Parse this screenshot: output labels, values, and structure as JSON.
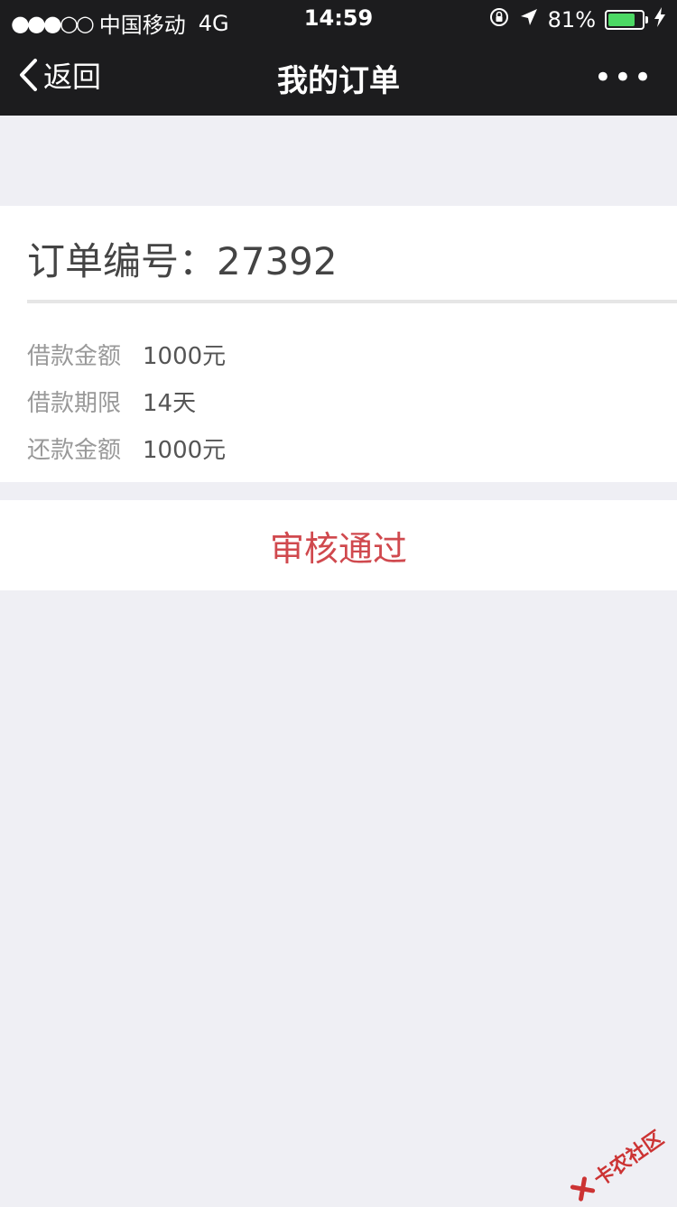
{
  "statusbar": {
    "signal": "●●●○○",
    "carrier": "中国移动",
    "network": "4G",
    "time": "14:59",
    "battery_percent_text": "81%",
    "battery_level": 0.81,
    "icons": [
      "orientation-lock-icon",
      "location-arrow-icon",
      "battery-icon",
      "charging-bolt-icon"
    ]
  },
  "nav": {
    "back_label": "返回",
    "title": "我的订单",
    "more_label": "•••"
  },
  "order": {
    "title_prefix": "订单编号：",
    "number": "27392",
    "details": [
      {
        "label": "借款金额",
        "value": "1000元"
      },
      {
        "label": "借款期限",
        "value": "14天"
      },
      {
        "label": "还款金额",
        "value": "1000元"
      }
    ]
  },
  "status": {
    "text": "审核通过",
    "color": "#d0494e"
  },
  "watermark": {
    "text": "卡农社区"
  },
  "colors": {
    "bar_bg": "#1c1c1e",
    "page_bg": "#efeff4",
    "battery_green": "#4cd964",
    "accent_red": "#d0494e"
  }
}
